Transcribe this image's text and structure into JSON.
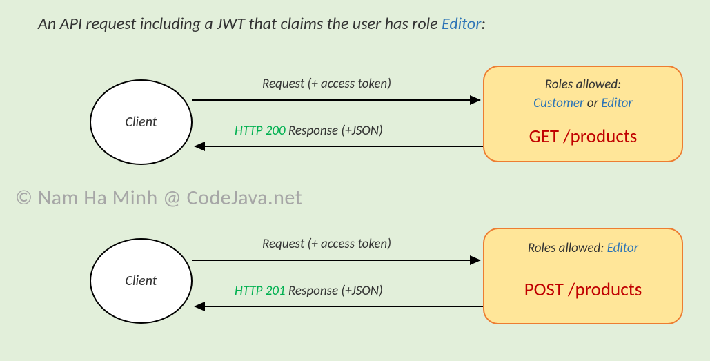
{
  "title": {
    "prefix": "An API request including a JWT that claims the user has role ",
    "role": "Editor",
    "suffix": ":"
  },
  "watermark": "© Nam Ha Minh @ CodeJava.net",
  "flow1": {
    "client_label": "Client",
    "request_label": "Request (+ access token)",
    "response_status": "HTTP 200",
    "response_suffix": " Response (+JSON)",
    "roles_label": "Roles allowed:",
    "role1": "Customer",
    "or": " or ",
    "role2": "Editor",
    "endpoint": "GET /products"
  },
  "flow2": {
    "client_label": "Client",
    "request_label": "Request (+ access token)",
    "response_status": "HTTP 201",
    "response_suffix": " Response (+JSON)",
    "roles_label": "Roles allowed:  ",
    "role1": "Editor",
    "endpoint": "POST /products"
  }
}
